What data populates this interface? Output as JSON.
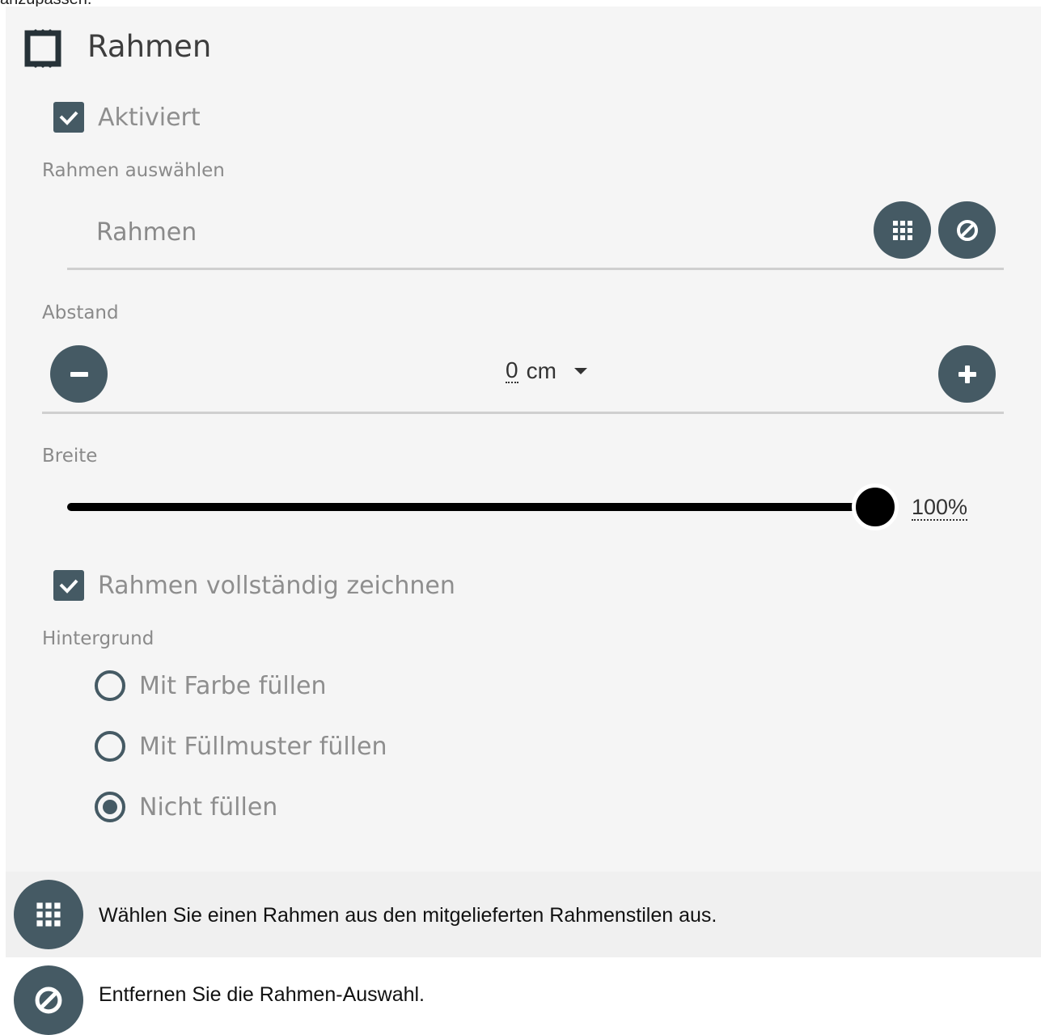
{
  "top_fragment": "anzupassen.",
  "header": {
    "title": "Rahmen",
    "icon": "frame-icon"
  },
  "enabled": {
    "label": "Aktiviert",
    "checked": true
  },
  "frame_select": {
    "section_label": "Rahmen auswählen",
    "input_text": "Rahmen",
    "grid_button_icon": "grid-icon",
    "remove_button_icon": "no-symbol-icon"
  },
  "spacing": {
    "section_label": "Abstand",
    "value": "0",
    "unit": "cm",
    "minus_icon": "minus-icon",
    "plus_icon": "plus-icon"
  },
  "width": {
    "section_label": "Breite",
    "value_label": "100%",
    "level": 1.0
  },
  "draw_full": {
    "label": "Rahmen vollständig zeichnen",
    "checked": true
  },
  "background": {
    "section_label": "Hintergrund",
    "options": [
      {
        "label": "Mit Farbe füllen",
        "selected": false
      },
      {
        "label": "Mit Füllmuster füllen",
        "selected": false
      },
      {
        "label": "Nicht füllen",
        "selected": true
      }
    ]
  },
  "legend": [
    {
      "icon": "grid-icon",
      "text": "Wählen Sie einen Rahmen aus den mitgelieferten Rahmenstilen aus."
    },
    {
      "icon": "no-symbol-icon",
      "text": "Entfernen Sie die Rahmen-Auswahl."
    }
  ],
  "colors": {
    "accent": "#455a64",
    "panel": "#f5f5f5",
    "divider": "#cfcfcf"
  }
}
